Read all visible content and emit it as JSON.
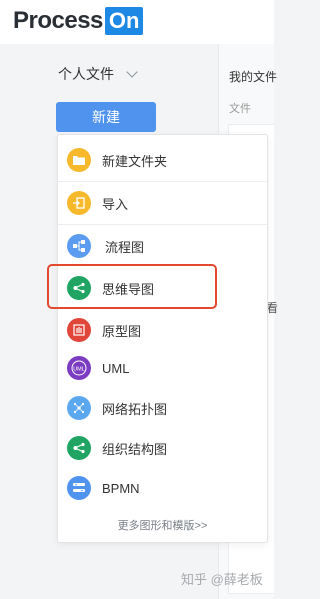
{
  "app": {
    "logo_text": "Process",
    "logo_box_text": "On"
  },
  "files_dropdown": {
    "label": "个人文件"
  },
  "right_panel": {
    "title": "我的文件",
    "subtitle": "文件",
    "edge_glyph": "看"
  },
  "new_button": {
    "label": "新建"
  },
  "menu": {
    "items": [
      {
        "label": "新建文件夹",
        "icon": "folder-icon",
        "color": "#f6b92b"
      },
      {
        "label": "导入",
        "icon": "import-icon",
        "color": "#f6b92b"
      },
      {
        "label": "流程图",
        "icon": "flowchart-icon",
        "color": "#5b9cf0"
      },
      {
        "label": "思维导图",
        "icon": "mindmap-icon",
        "color": "#1fa463"
      },
      {
        "label": "原型图",
        "icon": "prototype-icon",
        "color": "#e0463a"
      },
      {
        "label": "UML",
        "icon": "uml-icon",
        "color": "#7b3cc2"
      },
      {
        "label": "网络拓扑图",
        "icon": "network-topology-icon",
        "color": "#5ba8ef"
      },
      {
        "label": "组织结构图",
        "icon": "org-chart-icon",
        "color": "#1fa463"
      },
      {
        "label": "BPMN",
        "icon": "bpmn-icon",
        "color": "#4f93ef"
      }
    ],
    "more_link": "更多图形和模版>>"
  },
  "highlight_color": "#e2492f",
  "watermark": "知乎 @薛老板"
}
